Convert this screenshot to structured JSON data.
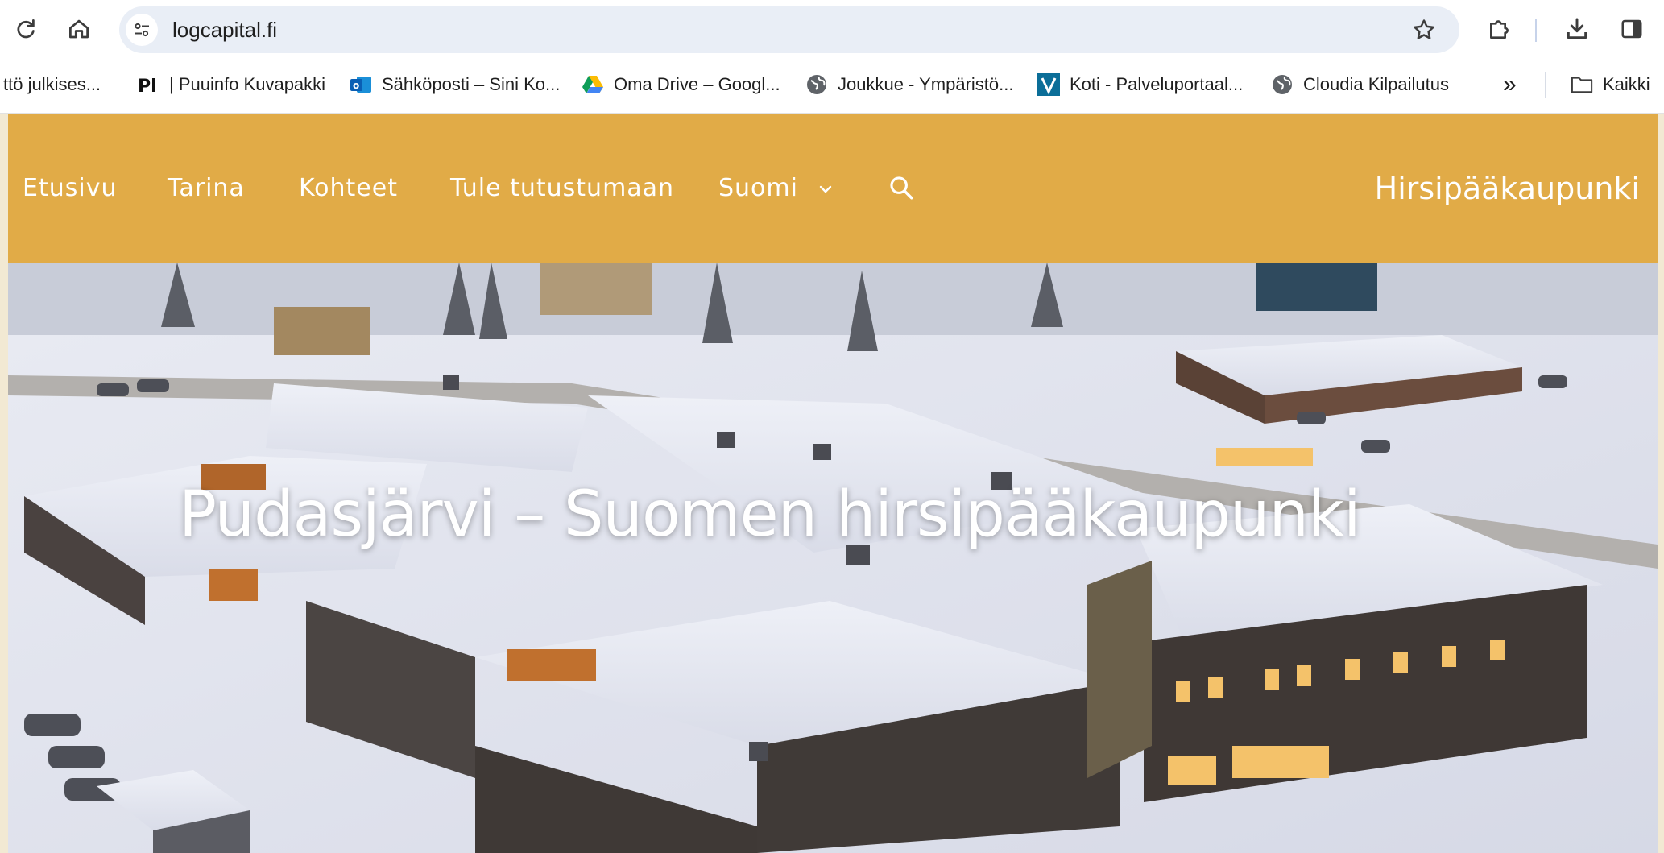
{
  "browser": {
    "url": "logcapital.fi",
    "icons": {
      "reload": "reload-icon",
      "home": "home-icon",
      "site_info": "tune-icon",
      "bookmark_star": "star-icon",
      "extensions": "puzzle-icon",
      "downloads": "download-icon",
      "side_panel": "side-panel-icon"
    }
  },
  "bookmarks": {
    "items": [
      {
        "label": "ttö julkises...",
        "icon": "none"
      },
      {
        "label": "| Puuinfo Kuvapakki",
        "icon": "puuinfo-logo-icon"
      },
      {
        "label": "Sähköposti – Sini Ko...",
        "icon": "outlook-icon"
      },
      {
        "label": "Oma Drive – Googl...",
        "icon": "google-drive-icon"
      },
      {
        "label": "Joukkue - Ympäristö...",
        "icon": "globe-icon"
      },
      {
        "label": "Koti - Palveluportaal...",
        "icon": "v-logo-icon"
      },
      {
        "label": "Cloudia Kilpailutus",
        "icon": "globe-icon"
      }
    ],
    "overflow_label": "»",
    "all_bookmarks_label": "Kaikki"
  },
  "site": {
    "nav": {
      "items": [
        "Etusivu",
        "Tarina",
        "Kohteet",
        "Tule tutustumaan"
      ],
      "language": "Suomi",
      "search_icon": "search-icon"
    },
    "brand": "Hirsipääkaupunki",
    "hero": {
      "title": "Pudasjärvi – Suomen hirsipääkaupunki"
    }
  },
  "colors": {
    "nav_background": "#e1ab47",
    "nav_text": "#ffffff",
    "omnibox": "#e9eef6"
  }
}
